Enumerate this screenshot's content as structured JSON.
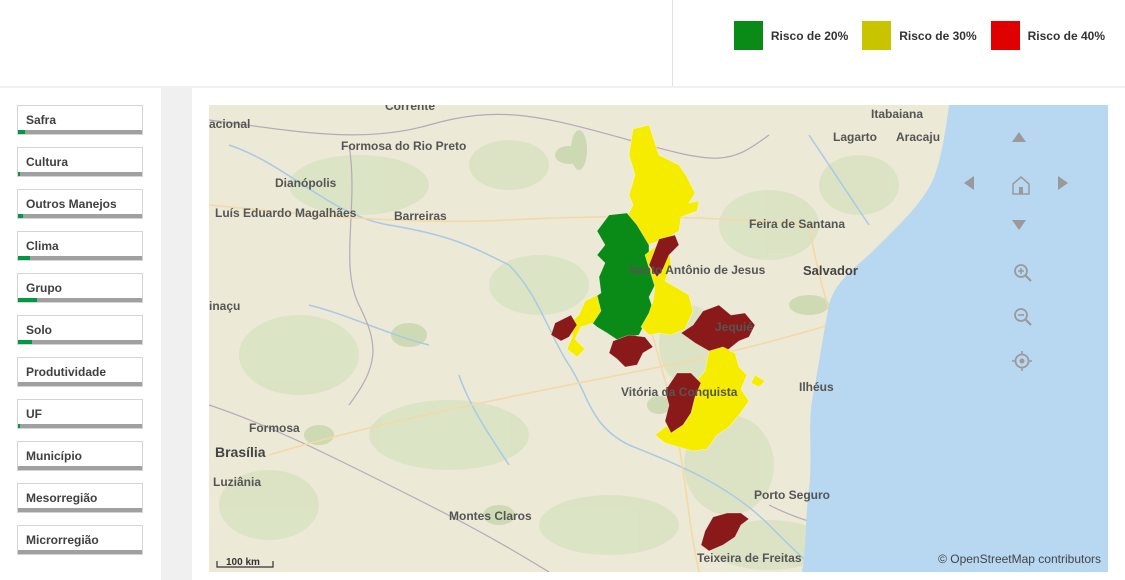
{
  "legend": {
    "items": [
      {
        "label": "Risco de 20%",
        "color": "#0a8a16"
      },
      {
        "label": "Risco de 30%",
        "color": "#c9c400"
      },
      {
        "label": "Risco de 40%",
        "color": "#e00000"
      }
    ]
  },
  "filters": [
    {
      "label": "Safra",
      "selected_fraction": 0.06
    },
    {
      "label": "Cultura",
      "selected_fraction": 0.02
    },
    {
      "label": "Outros Manejos",
      "selected_fraction": 0.04
    },
    {
      "label": "Clima",
      "selected_fraction": 0.1
    },
    {
      "label": "Grupo",
      "selected_fraction": 0.15
    },
    {
      "label": "Solo",
      "selected_fraction": 0.11
    },
    {
      "label": "Produtividade",
      "selected_fraction": 0
    },
    {
      "label": "UF",
      "selected_fraction": 0.02
    },
    {
      "label": "Município",
      "selected_fraction": 0
    },
    {
      "label": "Mesorregião",
      "selected_fraction": 0
    },
    {
      "label": "Microrregião",
      "selected_fraction": 0
    }
  ],
  "map": {
    "places": [
      {
        "name": "Corrente",
        "size": "small"
      },
      {
        "name": "Itabaiana",
        "size": "small"
      },
      {
        "name": "acional",
        "size": "small"
      },
      {
        "name": "Lagarto",
        "size": "small"
      },
      {
        "name": "Aracaju",
        "size": "small"
      },
      {
        "name": "Formosa do Rio Preto",
        "size": "small"
      },
      {
        "name": "Dianópolis",
        "size": "small"
      },
      {
        "name": "Luís Eduardo Magalhães",
        "size": "small"
      },
      {
        "name": "Barreiras",
        "size": "small"
      },
      {
        "name": "Feira de Santana",
        "size": "small"
      },
      {
        "name": "Santo Antônio de Jesus",
        "size": "small"
      },
      {
        "name": "Salvador",
        "size": "large"
      },
      {
        "name": "inaçu",
        "size": "small"
      },
      {
        "name": "Jequié",
        "size": "small"
      },
      {
        "name": "Vitória da Conquista",
        "size": "small"
      },
      {
        "name": "Ilhéus",
        "size": "small"
      },
      {
        "name": "Formosa",
        "size": "small"
      },
      {
        "name": "Brasília",
        "size": "large"
      },
      {
        "name": "Luziânia",
        "size": "small"
      },
      {
        "name": "Montes Claros",
        "size": "small"
      },
      {
        "name": "Porto Seguro",
        "size": "small"
      },
      {
        "name": "Teixeira de Freitas",
        "size": "small"
      }
    ],
    "scale_label": "100 km",
    "attribution": "© OpenStreetMap contributors",
    "controls": [
      "pan-up",
      "pan-left",
      "home",
      "pan-right",
      "pan-down",
      "zoom-in",
      "zoom-out",
      "locate"
    ]
  }
}
